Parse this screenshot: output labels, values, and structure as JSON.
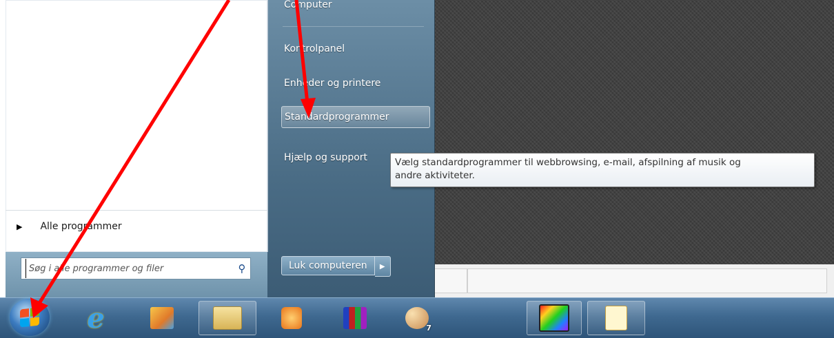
{
  "start_menu": {
    "right_items": {
      "computer": "Computer",
      "control_panel": "Kontrolpanel",
      "devices": "Enheder og printere",
      "default_programs": "Standardprogrammer",
      "help": "Hjælp og support"
    },
    "all_programs": "Alle programmer",
    "search_placeholder": "Søg i alle programmer og filer",
    "shutdown": "Luk computeren"
  },
  "tooltip": {
    "line1": "Vælg standardprogrammer til webbrowsing, e-mail, afspilning af musik og",
    "line2": "andre aktiviteter."
  },
  "taskbar": {
    "badge_count": "7",
    "icons": [
      "windows-start-icon",
      "internet-explorer-icon",
      "photo-gallery-icon",
      "file-explorer-icon",
      "media-player-icon",
      "paint-tool-icon",
      "paint-palette-icon",
      "film-gradient-icon",
      "image-viewer-icon"
    ]
  },
  "colors": {
    "annotation_arrow": "#ff0000",
    "accent": "#3f6990"
  }
}
